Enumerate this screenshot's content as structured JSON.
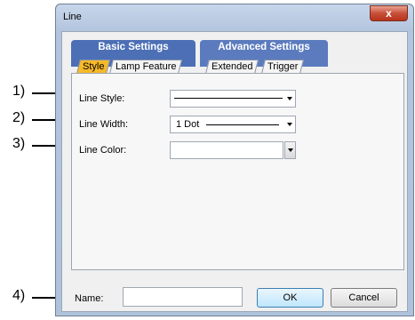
{
  "annotations": [
    "1)",
    "2)",
    "3)",
    "4)"
  ],
  "window": {
    "title": "Line",
    "close_glyph": "x"
  },
  "tabs": {
    "groups": [
      "Basic Settings",
      "Advanced Settings"
    ],
    "sub_tabs": [
      "Style",
      "Lamp Feature",
      "Extended",
      "Trigger"
    ],
    "active_tab": "Style"
  },
  "form": {
    "line_style_label": "Line Style:",
    "line_width_label": "Line Width:",
    "line_width_value": "1 Dot",
    "line_color_label": "Line Color:"
  },
  "footer": {
    "name_label": "Name:",
    "name_value": "",
    "ok_label": "OK",
    "cancel_label": "Cancel"
  },
  "icons": [
    "close-icon",
    "chevron-down-icon"
  ]
}
